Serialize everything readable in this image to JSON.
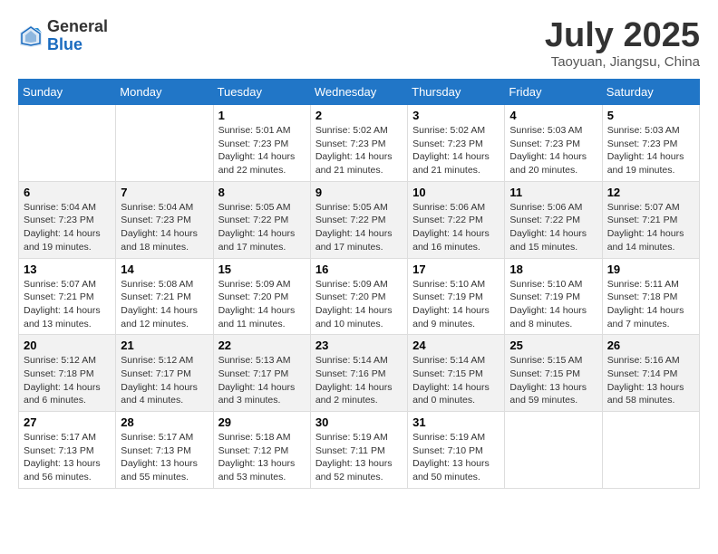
{
  "header": {
    "logo_general": "General",
    "logo_blue": "Blue",
    "month_title": "July 2025",
    "location": "Taoyuan, Jiangsu, China"
  },
  "weekdays": [
    "Sunday",
    "Monday",
    "Tuesday",
    "Wednesday",
    "Thursday",
    "Friday",
    "Saturday"
  ],
  "weeks": [
    [
      {
        "day": "",
        "info": ""
      },
      {
        "day": "",
        "info": ""
      },
      {
        "day": "1",
        "sunrise": "Sunrise: 5:01 AM",
        "sunset": "Sunset: 7:23 PM",
        "daylight": "Daylight: 14 hours and 22 minutes."
      },
      {
        "day": "2",
        "sunrise": "Sunrise: 5:02 AM",
        "sunset": "Sunset: 7:23 PM",
        "daylight": "Daylight: 14 hours and 21 minutes."
      },
      {
        "day": "3",
        "sunrise": "Sunrise: 5:02 AM",
        "sunset": "Sunset: 7:23 PM",
        "daylight": "Daylight: 14 hours and 21 minutes."
      },
      {
        "day": "4",
        "sunrise": "Sunrise: 5:03 AM",
        "sunset": "Sunset: 7:23 PM",
        "daylight": "Daylight: 14 hours and 20 minutes."
      },
      {
        "day": "5",
        "sunrise": "Sunrise: 5:03 AM",
        "sunset": "Sunset: 7:23 PM",
        "daylight": "Daylight: 14 hours and 19 minutes."
      }
    ],
    [
      {
        "day": "6",
        "sunrise": "Sunrise: 5:04 AM",
        "sunset": "Sunset: 7:23 PM",
        "daylight": "Daylight: 14 hours and 19 minutes."
      },
      {
        "day": "7",
        "sunrise": "Sunrise: 5:04 AM",
        "sunset": "Sunset: 7:23 PM",
        "daylight": "Daylight: 14 hours and 18 minutes."
      },
      {
        "day": "8",
        "sunrise": "Sunrise: 5:05 AM",
        "sunset": "Sunset: 7:22 PM",
        "daylight": "Daylight: 14 hours and 17 minutes."
      },
      {
        "day": "9",
        "sunrise": "Sunrise: 5:05 AM",
        "sunset": "Sunset: 7:22 PM",
        "daylight": "Daylight: 14 hours and 17 minutes."
      },
      {
        "day": "10",
        "sunrise": "Sunrise: 5:06 AM",
        "sunset": "Sunset: 7:22 PM",
        "daylight": "Daylight: 14 hours and 16 minutes."
      },
      {
        "day": "11",
        "sunrise": "Sunrise: 5:06 AM",
        "sunset": "Sunset: 7:22 PM",
        "daylight": "Daylight: 14 hours and 15 minutes."
      },
      {
        "day": "12",
        "sunrise": "Sunrise: 5:07 AM",
        "sunset": "Sunset: 7:21 PM",
        "daylight": "Daylight: 14 hours and 14 minutes."
      }
    ],
    [
      {
        "day": "13",
        "sunrise": "Sunrise: 5:07 AM",
        "sunset": "Sunset: 7:21 PM",
        "daylight": "Daylight: 14 hours and 13 minutes."
      },
      {
        "day": "14",
        "sunrise": "Sunrise: 5:08 AM",
        "sunset": "Sunset: 7:21 PM",
        "daylight": "Daylight: 14 hours and 12 minutes."
      },
      {
        "day": "15",
        "sunrise": "Sunrise: 5:09 AM",
        "sunset": "Sunset: 7:20 PM",
        "daylight": "Daylight: 14 hours and 11 minutes."
      },
      {
        "day": "16",
        "sunrise": "Sunrise: 5:09 AM",
        "sunset": "Sunset: 7:20 PM",
        "daylight": "Daylight: 14 hours and 10 minutes."
      },
      {
        "day": "17",
        "sunrise": "Sunrise: 5:10 AM",
        "sunset": "Sunset: 7:19 PM",
        "daylight": "Daylight: 14 hours and 9 minutes."
      },
      {
        "day": "18",
        "sunrise": "Sunrise: 5:10 AM",
        "sunset": "Sunset: 7:19 PM",
        "daylight": "Daylight: 14 hours and 8 minutes."
      },
      {
        "day": "19",
        "sunrise": "Sunrise: 5:11 AM",
        "sunset": "Sunset: 7:18 PM",
        "daylight": "Daylight: 14 hours and 7 minutes."
      }
    ],
    [
      {
        "day": "20",
        "sunrise": "Sunrise: 5:12 AM",
        "sunset": "Sunset: 7:18 PM",
        "daylight": "Daylight: 14 hours and 6 minutes."
      },
      {
        "day": "21",
        "sunrise": "Sunrise: 5:12 AM",
        "sunset": "Sunset: 7:17 PM",
        "daylight": "Daylight: 14 hours and 4 minutes."
      },
      {
        "day": "22",
        "sunrise": "Sunrise: 5:13 AM",
        "sunset": "Sunset: 7:17 PM",
        "daylight": "Daylight: 14 hours and 3 minutes."
      },
      {
        "day": "23",
        "sunrise": "Sunrise: 5:14 AM",
        "sunset": "Sunset: 7:16 PM",
        "daylight": "Daylight: 14 hours and 2 minutes."
      },
      {
        "day": "24",
        "sunrise": "Sunrise: 5:14 AM",
        "sunset": "Sunset: 7:15 PM",
        "daylight": "Daylight: 14 hours and 0 minutes."
      },
      {
        "day": "25",
        "sunrise": "Sunrise: 5:15 AM",
        "sunset": "Sunset: 7:15 PM",
        "daylight": "Daylight: 13 hours and 59 minutes."
      },
      {
        "day": "26",
        "sunrise": "Sunrise: 5:16 AM",
        "sunset": "Sunset: 7:14 PM",
        "daylight": "Daylight: 13 hours and 58 minutes."
      }
    ],
    [
      {
        "day": "27",
        "sunrise": "Sunrise: 5:17 AM",
        "sunset": "Sunset: 7:13 PM",
        "daylight": "Daylight: 13 hours and 56 minutes."
      },
      {
        "day": "28",
        "sunrise": "Sunrise: 5:17 AM",
        "sunset": "Sunset: 7:13 PM",
        "daylight": "Daylight: 13 hours and 55 minutes."
      },
      {
        "day": "29",
        "sunrise": "Sunrise: 5:18 AM",
        "sunset": "Sunset: 7:12 PM",
        "daylight": "Daylight: 13 hours and 53 minutes."
      },
      {
        "day": "30",
        "sunrise": "Sunrise: 5:19 AM",
        "sunset": "Sunset: 7:11 PM",
        "daylight": "Daylight: 13 hours and 52 minutes."
      },
      {
        "day": "31",
        "sunrise": "Sunrise: 5:19 AM",
        "sunset": "Sunset: 7:10 PM",
        "daylight": "Daylight: 13 hours and 50 minutes."
      },
      {
        "day": "",
        "info": ""
      },
      {
        "day": "",
        "info": ""
      }
    ]
  ]
}
